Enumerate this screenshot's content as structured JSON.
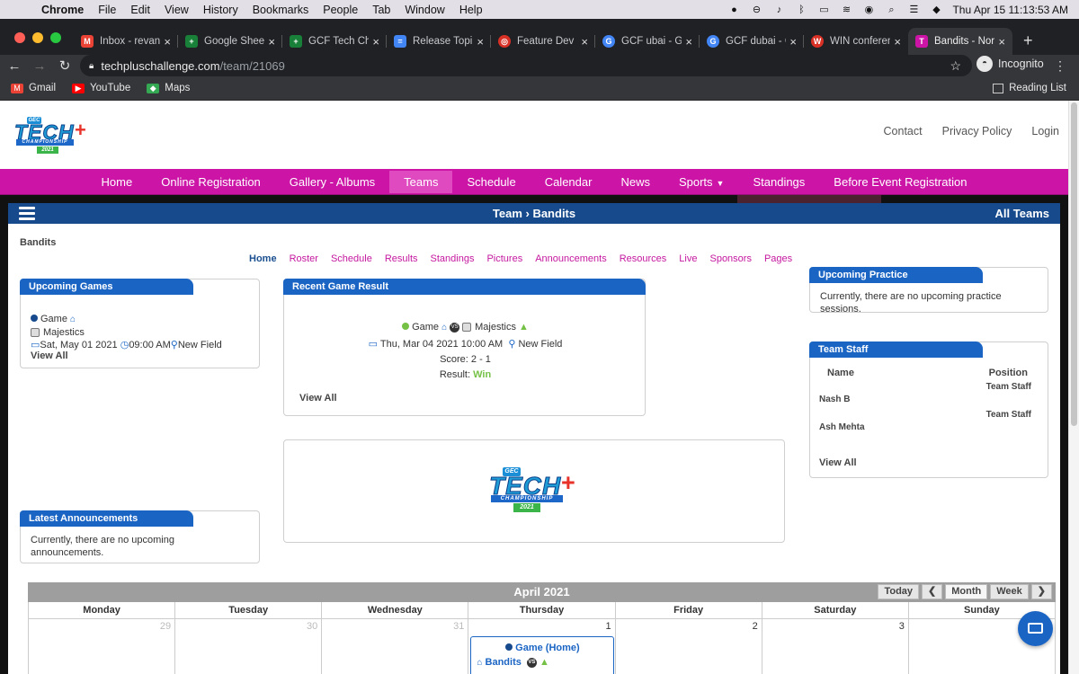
{
  "menubar": {
    "app": "Chrome",
    "items": [
      "File",
      "Edit",
      "View",
      "History",
      "Bookmarks",
      "People",
      "Tab",
      "Window",
      "Help"
    ],
    "datetime": "Thu Apr 15  11:13:53 AM"
  },
  "tabs": [
    {
      "title": "Inbox - revan",
      "fav": "M",
      "color": "#ea4335"
    },
    {
      "title": "Google Sheet",
      "fav": "+",
      "color": "#188038"
    },
    {
      "title": "GCF Tech Ch",
      "fav": "+",
      "color": "#188038"
    },
    {
      "title": "Release Topi",
      "fav": "=",
      "color": "#4285f4"
    },
    {
      "title": "Feature Dev",
      "fav": "◎",
      "color": "#d93025"
    },
    {
      "title": "GCF ubai - G",
      "fav": "G",
      "color": "#4285f4"
    },
    {
      "title": "GCF dubai - G",
      "fav": "G",
      "color": "#4285f4"
    },
    {
      "title": "WIN conferen",
      "fav": "W",
      "color": "#d93025"
    },
    {
      "title": "Bandits - Nor",
      "fav": "T",
      "color": "#cc14a7"
    }
  ],
  "address": {
    "host": "techpluschallenge.com",
    "path": "/team/21069",
    "incognito": "Incognito"
  },
  "bookmarks": [
    {
      "label": "Gmail",
      "color": "#ea4335",
      "icon": "M"
    },
    {
      "label": "YouTube",
      "color": "#ff0000",
      "icon": "▶"
    },
    {
      "label": "Maps",
      "color": "#34a853",
      "icon": "◆"
    }
  ],
  "reading_list": "Reading List",
  "logo": {
    "gec": "GEC",
    "tech": "TECH",
    "plus": "+",
    "champ": "CHAMPIONSHIP",
    "year": "2021"
  },
  "toplinks": [
    "Contact",
    "Privacy Policy",
    "Login"
  ],
  "mainnav": [
    "Home",
    "Online Registration",
    "Gallery - Albums",
    "Teams",
    "Schedule",
    "Calendar",
    "News",
    "Sports",
    "Standings",
    "Before Event Registration"
  ],
  "teambar": {
    "title": "Team  ›  Bandits",
    "all_teams": "All Teams"
  },
  "team_name": "Bandits",
  "subnav": [
    "Home",
    "Roster",
    "Schedule",
    "Results",
    "Standings",
    "Pictures",
    "Announcements",
    "Resources",
    "Live",
    "Sponsors",
    "Pages"
  ],
  "upcoming_games": {
    "title": "Upcoming Games",
    "type": "Game",
    "opponent": "Majestics",
    "date": "Sat, May 01 2021",
    "time": "09:00 AM",
    "location": "New Field",
    "view_all": "View All"
  },
  "recent_result": {
    "title": "Recent Game Result",
    "type": "Game",
    "opponent": "Majestics",
    "date": "Thu, Mar 04 2021 10:00 AM",
    "location": "New Field",
    "score": "Score: 2 - 1",
    "result_label": "Result:",
    "result": "Win",
    "view_all": "View All"
  },
  "latest_announcements": {
    "title": "Latest Announcements",
    "text": "Currently, there are no upcoming announcements."
  },
  "upcoming_practice": {
    "title": "Upcoming Practice",
    "text": "Currently, there are no upcoming practice sessions."
  },
  "team_staff": {
    "title": "Team Staff",
    "col_name": "Name",
    "col_position": "Position",
    "rows": [
      {
        "name": "Nash B",
        "position": "Team Staff"
      },
      {
        "name": "Ash Mehta",
        "position": "Team Staff"
      }
    ],
    "view_all": "View All"
  },
  "calendar": {
    "month": "April 2021",
    "buttons": {
      "today": "Today",
      "prev": "❮",
      "month": "Month",
      "week": "Week",
      "next": "❯"
    },
    "days": [
      "Monday",
      "Tuesday",
      "Wednesday",
      "Thursday",
      "Friday",
      "Saturday",
      "Sunday"
    ],
    "dates": [
      "29",
      "30",
      "31",
      "1",
      "2",
      "3",
      ""
    ],
    "event": {
      "title": "Game (Home)",
      "team": "Bandits"
    }
  }
}
